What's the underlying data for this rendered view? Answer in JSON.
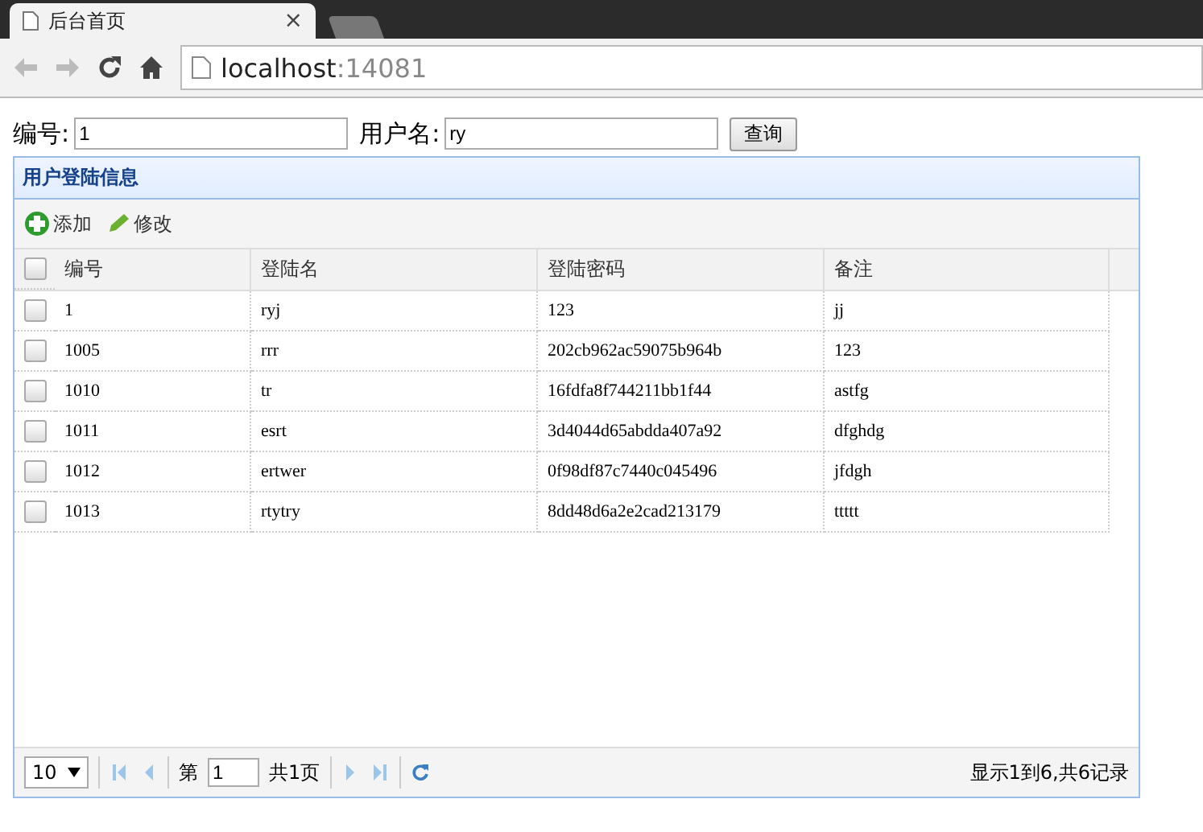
{
  "browser": {
    "tab_title": "后台首页",
    "tab_close": "×",
    "address_host": "localhost",
    "address_port": ":14081"
  },
  "search": {
    "fields": [
      {
        "label": "编号:",
        "value": "1"
      },
      {
        "label": "用户名:",
        "value": "ry"
      }
    ],
    "button": "查询"
  },
  "panel": {
    "title": "用户登陆信息",
    "toolbar": [
      {
        "kind": "add",
        "label": "添加"
      },
      {
        "kind": "edit",
        "label": "修改"
      }
    ],
    "table": {
      "all_checked": false,
      "columns": [
        "编号",
        "登陆名",
        "登陆密码",
        "备注"
      ],
      "rows": [
        {
          "checked": false,
          "cells": [
            "1",
            "ryj",
            "123",
            "jj"
          ]
        },
        {
          "checked": false,
          "cells": [
            "1005",
            "rrr",
            "202cb962ac59075b964b",
            "123"
          ]
        },
        {
          "checked": false,
          "cells": [
            "1010",
            "tr",
            "16fdfa8f744211bb1f44",
            "astfg"
          ]
        },
        {
          "checked": false,
          "cells": [
            "1011",
            "esrt",
            "3d4044d65abdda407a92",
            "dfghdg"
          ]
        },
        {
          "checked": false,
          "cells": [
            "1012",
            "ertwer",
            "0f98df87c7440c045496",
            "jfdgh"
          ]
        },
        {
          "checked": false,
          "cells": [
            "1013",
            "rtytry",
            "8dd48d6a2e2cad213179",
            "ttttt"
          ]
        }
      ]
    },
    "pager": {
      "page_size": "10",
      "page_prefix": "第",
      "page": "1",
      "page_suffix": "共1页",
      "summary": "显示1到6,共6记录"
    }
  }
}
